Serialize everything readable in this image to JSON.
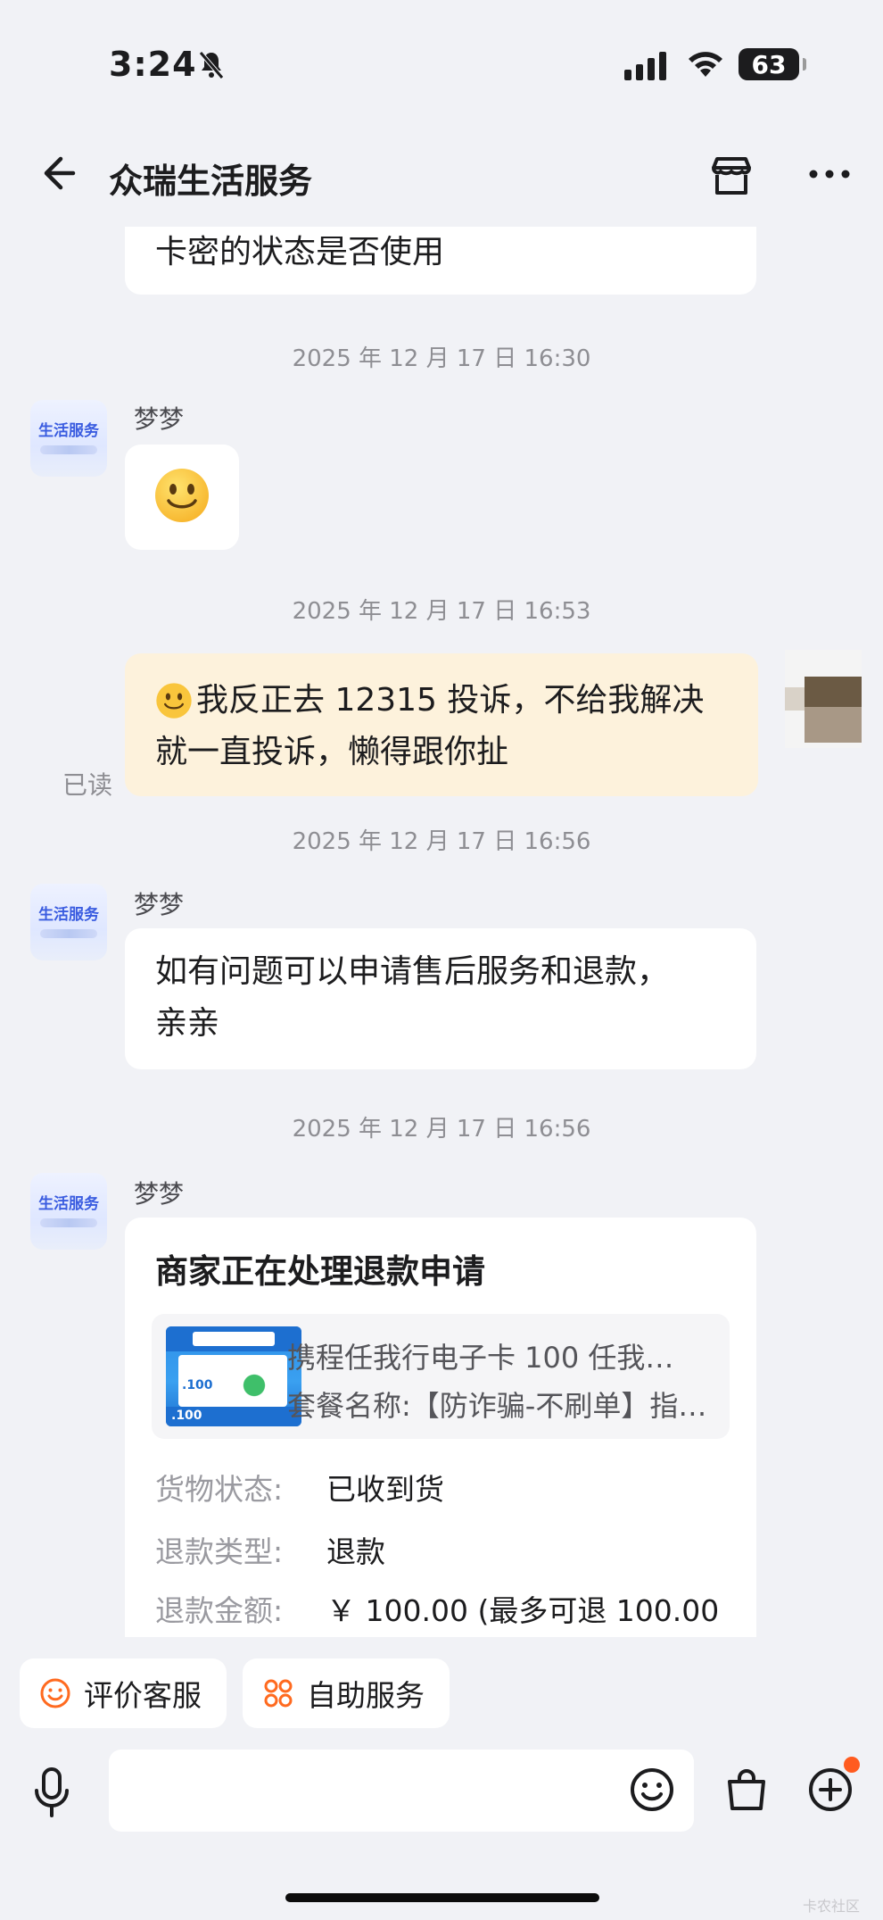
{
  "status": {
    "time": "3:24",
    "battery": "63"
  },
  "nav": {
    "title": "众瑞生活服务"
  },
  "messages": {
    "m0_text": "卡密的状态是否使用",
    "ts1": "2025 年 12 月 17 日 16:30",
    "m1_sender": "梦梦",
    "ts2": "2025 年 12 月 17 日 16:53",
    "m2_line1": "我反正去 12315 投诉，不给我解决",
    "m2_line2": "就一直投诉，懒得跟你扯",
    "read_label": "已读",
    "ts3": "2025 年 12 月 17 日 16:56",
    "m3_sender": "梦梦",
    "m3_line1": "如有问题可以申请售后服务和退款，",
    "m3_line2": "亲亲",
    "ts4": "2025 年 12 月 17 日 16:56",
    "m4_sender": "梦梦"
  },
  "avatar": {
    "label": "生活服务"
  },
  "order_card": {
    "title": "商家正在处理退款申请",
    "product_name": "携程任我行电子卡 100 任我…",
    "product_package": "套餐名称:【防诈骗-不刷单】指…",
    "rows": [
      {
        "label": "货物状态:",
        "value": "已收到货"
      },
      {
        "label": "退款类型:",
        "value": "退款"
      },
      {
        "label": "退款金额:",
        "value": "￥ 100.00 (最多可退 100.00"
      }
    ]
  },
  "quick_actions": [
    {
      "label": "评价客服",
      "icon": "smile-icon"
    },
    {
      "label": "自助服务",
      "icon": "grid-icon"
    }
  ],
  "input_bar": {
    "placeholder": ""
  },
  "accent_color": "#ff6a1f",
  "watermark": "卡农社区"
}
